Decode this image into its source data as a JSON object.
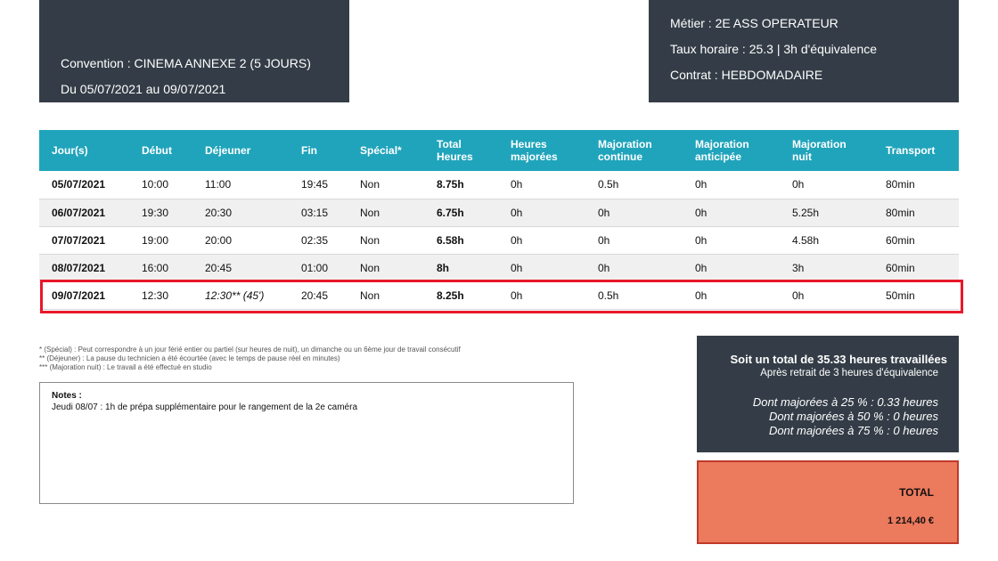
{
  "header": {
    "convention": "Convention : CINEMA ANNEXE 2 (5 JOURS)",
    "period": "Du 05/07/2021 au 09/07/2021",
    "job": "Métier : 2E ASS OPERATEUR",
    "rate": "Taux horaire : 25.3 | 3h d'équivalence",
    "contract": "Contrat : HEBDOMADAIRE"
  },
  "table": {
    "columns": [
      {
        "line1": "Jour(s)",
        "line2": ""
      },
      {
        "line1": "Début",
        "line2": ""
      },
      {
        "line1": "Déjeuner",
        "line2": ""
      },
      {
        "line1": "Fin",
        "line2": ""
      },
      {
        "line1": "Spécial*",
        "line2": ""
      },
      {
        "line1": "Total",
        "line2": "Heures"
      },
      {
        "line1": "Heures",
        "line2": "majorées"
      },
      {
        "line1": "Majoration",
        "line2": "continue"
      },
      {
        "line1": "Majoration",
        "line2": "anticipée"
      },
      {
        "line1": "Majoration",
        "line2": "nuit"
      },
      {
        "line1": "Transport",
        "line2": ""
      }
    ],
    "rows": [
      [
        "05/07/2021",
        "10:00",
        "11:00",
        "19:45",
        "Non",
        "8.75h",
        "0h",
        "0.5h",
        "0h",
        "0h",
        "80min"
      ],
      [
        "06/07/2021",
        "19:30",
        "20:30",
        "03:15",
        "Non",
        "6.75h",
        "0h",
        "0h",
        "0h",
        "5.25h",
        "80min"
      ],
      [
        "07/07/2021",
        "19:00",
        "20:00",
        "02:35",
        "Non",
        "6.58h",
        "0h",
        "0h",
        "0h",
        "4.58h",
        "60min"
      ],
      [
        "08/07/2021",
        "16:00",
        "20:45",
        "01:00",
        "Non",
        "8h",
        "0h",
        "0h",
        "0h",
        "3h",
        "60min"
      ],
      [
        "09/07/2021",
        "12:30",
        "12:30** (45')",
        "20:45",
        "Non",
        "8.25h",
        "0h",
        "0.5h",
        "0h",
        "0h",
        "50min"
      ]
    ],
    "italic_cells": [
      [
        4,
        2
      ]
    ]
  },
  "footnotes": [
    "* (Spécial) : Peut correspondre à un jour férié entier ou partiel (sur heures de nuit), un dimanche ou un 6ème jour de travail consécutif",
    "** (Déjeuner) : La pause du technicien a été écourtée (avec le temps de pause réel en minutes)",
    "*** (Majoration nuit) : Le travail a été effectué en studio"
  ],
  "notes": {
    "title": "Notes :",
    "text": "Jeudi 08/07 : 1h de prépa supplémentaire pour le rangement de la 2e caméra"
  },
  "summary": {
    "total_line": "Soit un total de 35.33 heures travaillées",
    "retrait_line": "Après retrait de 3 heures d'équivalence",
    "maj25": "Dont majorées à 25 % : 0.33 heures",
    "maj50": "Dont majorées à 50 % : 0 heures",
    "maj75": "Dont majorées à 75 % : 0 heures"
  },
  "total": {
    "label": "TOTAL",
    "amount": "1 214,40 €"
  },
  "colors": {
    "dark_panel": "#343d47",
    "table_header": "#20a4bb",
    "highlight_border": "#e8182a",
    "total_panel": "#ec7a5c"
  }
}
